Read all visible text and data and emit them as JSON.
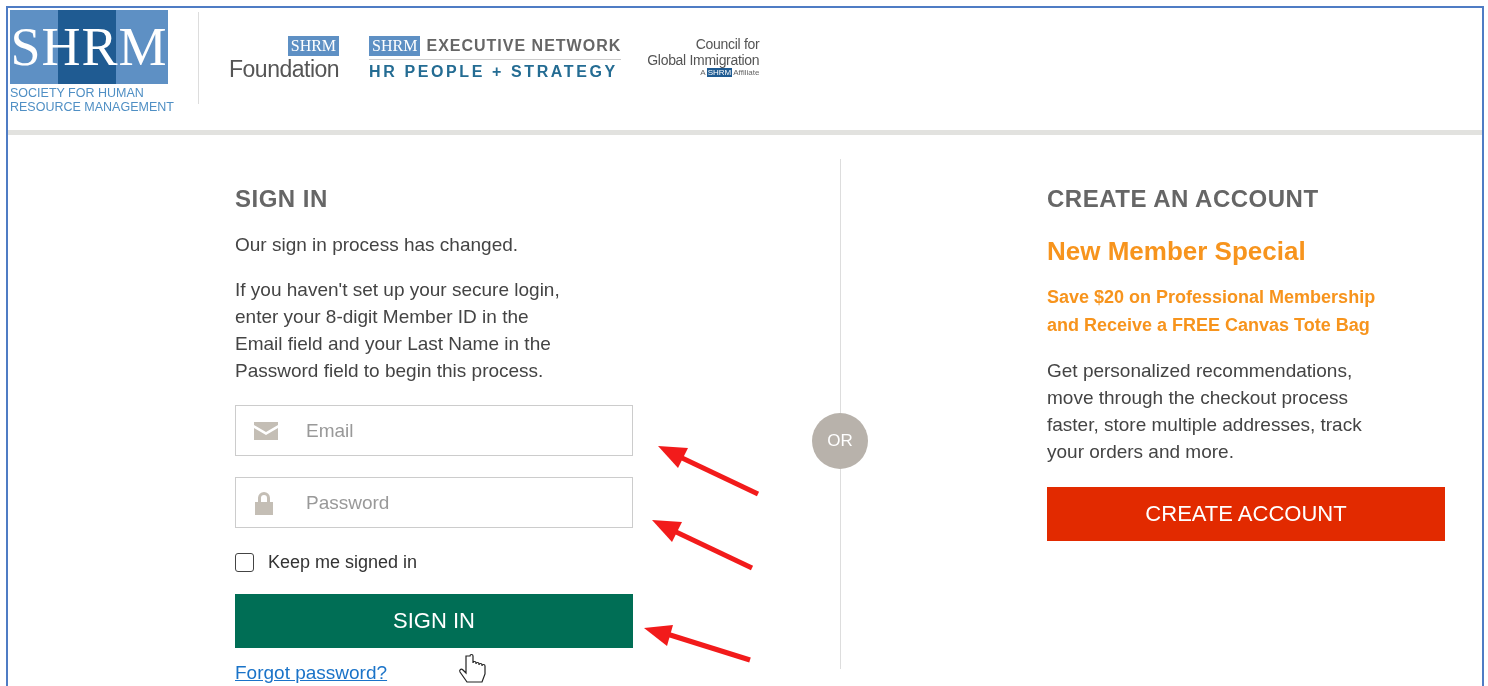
{
  "header": {
    "logo": {
      "mark": "SHRM",
      "lines": [
        "SOCIETY FOR HUMAN",
        "RESOURCE MANAGEMENT"
      ]
    },
    "foundation": {
      "mark": "SHRM",
      "name": "Foundation"
    },
    "executive": {
      "mark": "SHRM",
      "name": "EXECUTIVE NETWORK",
      "tagline": "HR PEOPLE + STRATEGY"
    },
    "council": {
      "lines": [
        "Council for",
        "Global Immigration"
      ],
      "affiliate_prefix": "A",
      "affiliate_mark": "SHRM",
      "affiliate_suffix": "Affiliate"
    }
  },
  "sign_in": {
    "title": "SIGN IN",
    "notice": "Our sign in process has changed.",
    "instructions": [
      "If you haven't set up your secure login,",
      "enter your 8-digit Member ID in the",
      "Email field and your Last Name in the",
      "Password field to begin this process."
    ],
    "fields": [
      {
        "kind": "email",
        "placeholder": "Email"
      },
      {
        "kind": "password",
        "placeholder": "Password"
      }
    ],
    "keep_signed_in": {
      "label": "Keep me signed in",
      "checked": false
    },
    "button": "SIGN IN",
    "forgot_link": "Forgot password?"
  },
  "divider_label": "OR",
  "create_account": {
    "title": "CREATE AN ACCOUNT",
    "subtitle": "New Member Special",
    "offer": [
      "Save $20 on Professional Membership",
      "and Receive a FREE Canvas Tote Bag"
    ],
    "description": [
      "Get personalized recommendations,",
      "move through the checkout process",
      "faster, store multiple addresses, track",
      "your orders and more."
    ],
    "button": "CREATE ACCOUNT"
  }
}
